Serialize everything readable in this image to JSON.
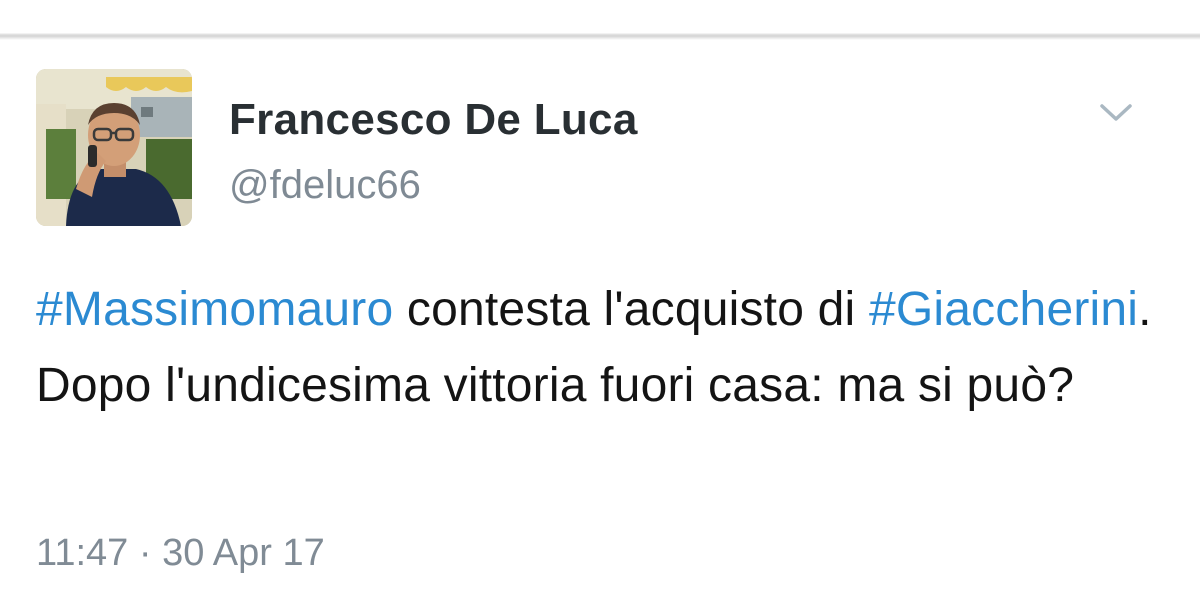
{
  "author": {
    "name": "Francesco De Luca",
    "handle": "@fdeluc66"
  },
  "tweet": {
    "hashtag1": "#Massimomauro",
    "text1": " contesta l'acquisto di ",
    "hashtag2": "#Giaccherini",
    "text2": ". Dopo l'undicesima vittoria fuori casa: ma si può?"
  },
  "meta": {
    "time": "11:47",
    "separator": " · ",
    "date": "30 Apr 17"
  },
  "icons": {
    "menu": "chevron-down-icon",
    "avatar": "avatar"
  },
  "colors": {
    "hashtag": "#2b8ad2",
    "name": "#292f33",
    "secondary": "#808b95",
    "text": "#141414"
  }
}
